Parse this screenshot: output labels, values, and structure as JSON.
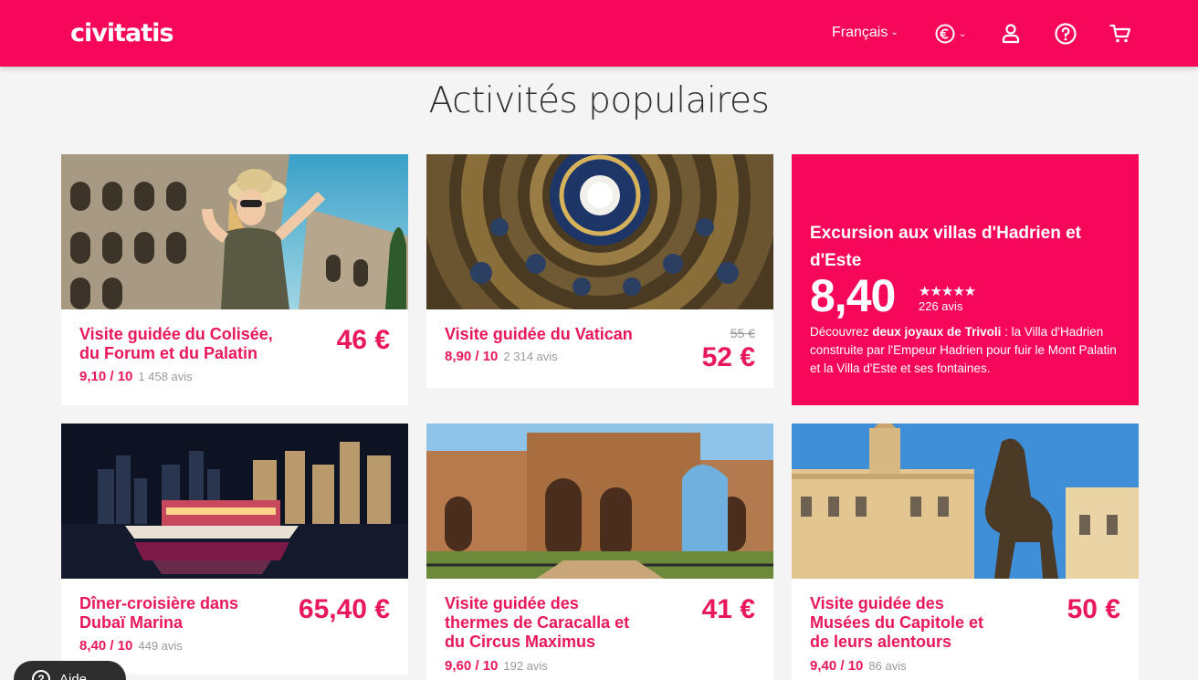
{
  "header": {
    "logo": "civitatis",
    "language": "Français",
    "currency_icon": "euro-icon",
    "icons": [
      "user-icon",
      "help-icon",
      "cart-icon"
    ],
    "brand_color": "#f70759"
  },
  "page_title": "Activités populaires",
  "cards": [
    {
      "title_l1": "Visite guidée du Colisée,",
      "title_l2": "du Forum et du Palatin",
      "price": "46 €",
      "rating": "9,10 / 10",
      "reviews": "1 458 avis"
    },
    {
      "title_l1": "Visite guidée du Vatican",
      "old_price": "55 €",
      "price": "52 €",
      "rating": "8,90 / 10",
      "reviews": "2 314 avis"
    },
    {
      "title_l1": "Dîner-croisière dans",
      "title_l2": "Dubaï Marina",
      "price": "65,40 €",
      "rating": "8,40 / 10",
      "reviews": "449 avis"
    },
    {
      "title_l1": "Visite guidée des",
      "title_l2": "thermes de Caracalla et",
      "title_l3": "du Circus Maximus",
      "price": "41 €",
      "rating": "9,60 / 10",
      "reviews": "192 avis"
    },
    {
      "title_l1": "Visite guidée des",
      "title_l2": "Musées du Capitole et",
      "title_l3": "de leurs alentours",
      "price": "50 €",
      "rating": "9,40 / 10",
      "reviews": "86 avis"
    }
  ],
  "promo": {
    "title": "Excursion aux villas d'Hadrien et d'Este",
    "score": "8,40",
    "stars": "★★★★★",
    "reviews": "226 avis",
    "desc_pre": "Découvrez ",
    "desc_bold": "deux joyaux de Trivoli",
    "desc_post": " : la Villa d'Hadrien construite par l'Empeur Hadrien pour fuir le Mont Palatin et la Villa d'Este et ses fontaines."
  },
  "help": {
    "label": "Aide"
  }
}
